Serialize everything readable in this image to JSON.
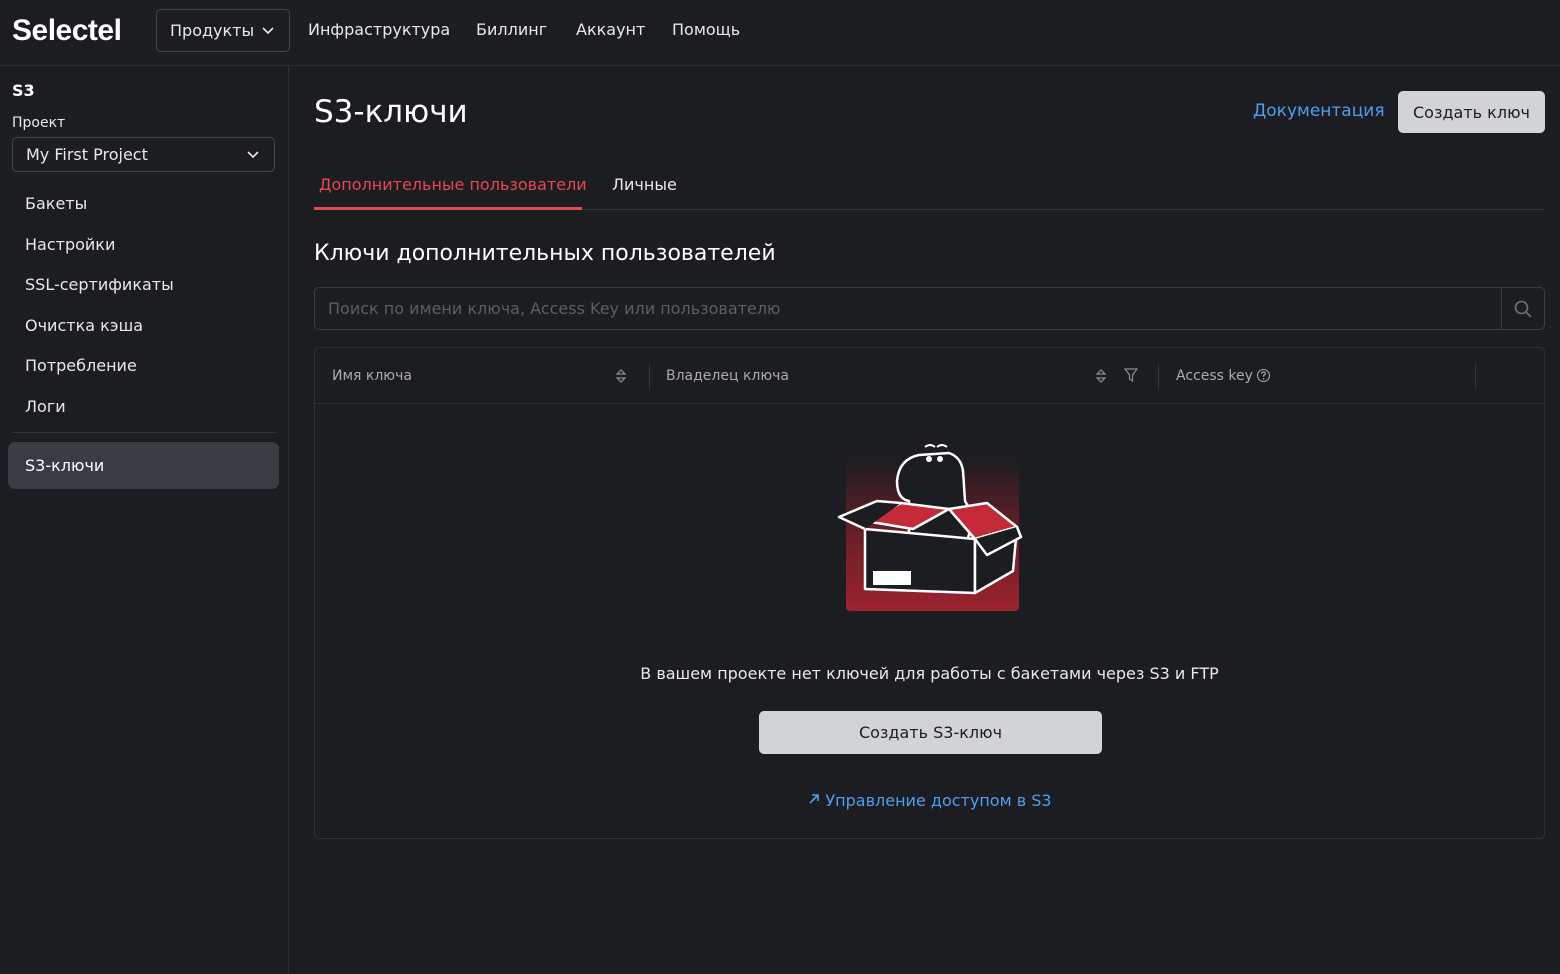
{
  "header": {
    "logo": "Selectel",
    "products_label": "Продукты",
    "nav": [
      "Инфраструктура",
      "Биллинг",
      "Аккаунт",
      "Помощь"
    ]
  },
  "sidebar": {
    "service": "S3",
    "project_label": "Проект",
    "project_value": "My First Project",
    "items": [
      "Бакеты",
      "Настройки",
      "SSL-сертификаты",
      "Очистка кэша",
      "Потребление",
      "Логи"
    ],
    "active_item": "S3-ключи"
  },
  "main": {
    "title": "S3-ключи",
    "doc_link": "Документация",
    "create_button": "Создать ключ",
    "tabs": [
      {
        "label": "Дополнительные пользователи",
        "active": true
      },
      {
        "label": "Личные",
        "active": false
      }
    ],
    "section_title": "Ключи дополнительных пользователей",
    "search": {
      "placeholder": "Поиск по имени ключа, Access Key или пользователю",
      "value": ""
    },
    "table": {
      "columns": [
        "Имя ключа",
        "Владелец ключа",
        "Access key"
      ]
    },
    "empty": {
      "text": "В вашем проекте нет ключей для работы с бакетами через S3 и FTP",
      "button": "Создать S3-ключ",
      "link": "Управление доступом в S3"
    }
  },
  "colors": {
    "background": "#1c1d21",
    "accent_red": "#e5484d",
    "link_blue": "#4d9ff0",
    "button_light": "#d2d3d6"
  }
}
